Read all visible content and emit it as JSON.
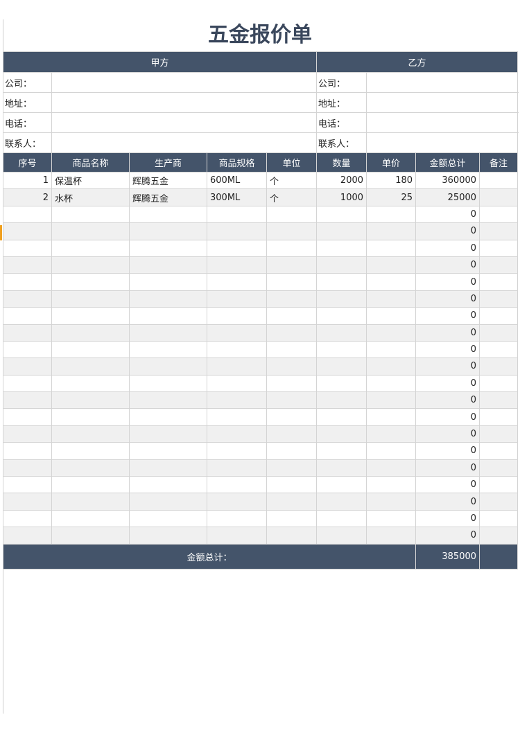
{
  "title": "五金报价单",
  "party_a": {
    "heading": "甲方",
    "fields": [
      {
        "label": "公司：",
        "value": ""
      },
      {
        "label": "地址：",
        "value": ""
      },
      {
        "label": "电话：",
        "value": ""
      },
      {
        "label": "联系人：",
        "value": ""
      }
    ]
  },
  "party_b": {
    "heading": "乙方",
    "fields": [
      {
        "label": "公司：",
        "value": ""
      },
      {
        "label": "地址：",
        "value": ""
      },
      {
        "label": "电话：",
        "value": ""
      },
      {
        "label": "联系人：",
        "value": ""
      }
    ]
  },
  "columns": [
    "序号",
    "商品名称",
    "生产商",
    "商品规格",
    "单位",
    "数量",
    "单价",
    "金额总计",
    "备注"
  ],
  "rows": [
    [
      "1",
      "保温杯",
      "辉腾五金",
      "600ML",
      "个",
      "2000",
      "180",
      "360000",
      ""
    ],
    [
      "2",
      "水杯",
      "辉腾五金",
      "300ML",
      "个",
      "1000",
      "25",
      "25000",
      ""
    ],
    [
      "",
      "",
      "",
      "",
      "",
      "",
      "",
      "0",
      ""
    ],
    [
      "",
      "",
      "",
      "",
      "",
      "",
      "",
      "0",
      ""
    ],
    [
      "",
      "",
      "",
      "",
      "",
      "",
      "",
      "0",
      ""
    ],
    [
      "",
      "",
      "",
      "",
      "",
      "",
      "",
      "0",
      ""
    ],
    [
      "",
      "",
      "",
      "",
      "",
      "",
      "",
      "0",
      ""
    ],
    [
      "",
      "",
      "",
      "",
      "",
      "",
      "",
      "0",
      ""
    ],
    [
      "",
      "",
      "",
      "",
      "",
      "",
      "",
      "0",
      ""
    ],
    [
      "",
      "",
      "",
      "",
      "",
      "",
      "",
      "0",
      ""
    ],
    [
      "",
      "",
      "",
      "",
      "",
      "",
      "",
      "0",
      ""
    ],
    [
      "",
      "",
      "",
      "",
      "",
      "",
      "",
      "0",
      ""
    ],
    [
      "",
      "",
      "",
      "",
      "",
      "",
      "",
      "0",
      ""
    ],
    [
      "",
      "",
      "",
      "",
      "",
      "",
      "",
      "0",
      ""
    ],
    [
      "",
      "",
      "",
      "",
      "",
      "",
      "",
      "0",
      ""
    ],
    [
      "",
      "",
      "",
      "",
      "",
      "",
      "",
      "0",
      ""
    ],
    [
      "",
      "",
      "",
      "",
      "",
      "",
      "",
      "0",
      ""
    ],
    [
      "",
      "",
      "",
      "",
      "",
      "",
      "",
      "0",
      ""
    ],
    [
      "",
      "",
      "",
      "",
      "",
      "",
      "",
      "0",
      ""
    ],
    [
      "",
      "",
      "",
      "",
      "",
      "",
      "",
      "0",
      ""
    ],
    [
      "",
      "",
      "",
      "",
      "",
      "",
      "",
      "0",
      ""
    ],
    [
      "",
      "",
      "",
      "",
      "",
      "",
      "",
      "0",
      ""
    ]
  ],
  "total": {
    "label": "金额总计：",
    "value": "385000"
  }
}
